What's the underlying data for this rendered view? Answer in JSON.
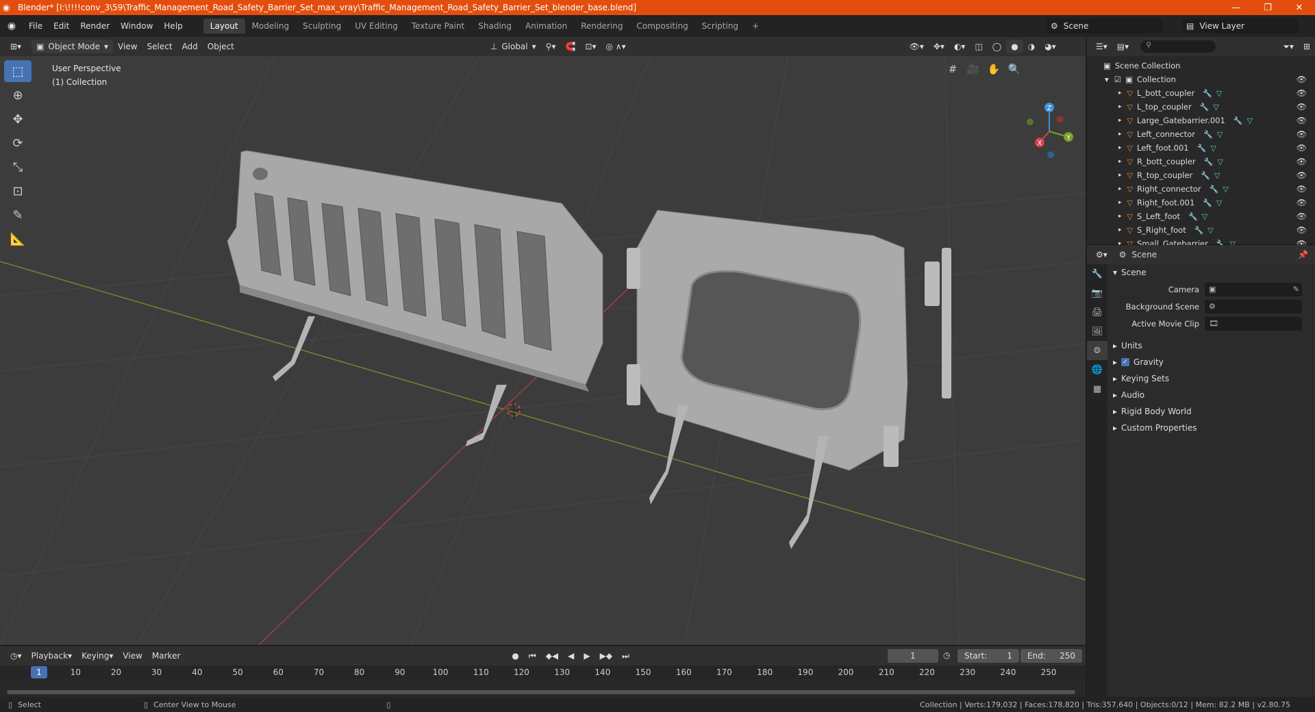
{
  "titlebar": {
    "text": "Blender* [I:\\!!!!conv_3\\59\\Traffic_Management_Road_Safety_Barrier_Set_max_vray\\Traffic_Management_Road_Safety_Barrier_Set_blender_base.blend]",
    "minimize": "—",
    "maximize": "❐",
    "close": "✕"
  },
  "menu": [
    "File",
    "Edit",
    "Render",
    "Window",
    "Help"
  ],
  "workspaces": [
    "Layout",
    "Modeling",
    "Sculpting",
    "UV Editing",
    "Texture Paint",
    "Shading",
    "Animation",
    "Rendering",
    "Compositing",
    "Scripting"
  ],
  "workspace_add": "+",
  "scene_name": "Scene",
  "view_layer": "View Layer",
  "viewport_header": {
    "mode": "Object Mode",
    "view": "View",
    "select": "Select",
    "add": "Add",
    "object": "Object",
    "orientation": "Global"
  },
  "viewport": {
    "perspective": "User Perspective",
    "collection": "(1) Collection",
    "gizmo_axes": {
      "x": "X",
      "y": "Y",
      "z": "Z"
    }
  },
  "timeline": {
    "playback": "Playback",
    "keying": "Keying",
    "view": "View",
    "marker": "Marker",
    "current_frame": "1",
    "start_label": "Start:",
    "start": "1",
    "end_label": "End:",
    "end": "250",
    "ruler": [
      "10",
      "20",
      "30",
      "40",
      "50",
      "60",
      "70",
      "80",
      "90",
      "100",
      "110",
      "120",
      "130",
      "140",
      "150",
      "160",
      "170",
      "180",
      "190",
      "200",
      "210",
      "220",
      "230",
      "240",
      "250"
    ]
  },
  "statusbar": {
    "select": "Select",
    "center_view": "Center View to Mouse",
    "stats": "Collection | Verts:179,032 | Faces:178,820 | Tris:357,640 | Objects:0/12 | Mem: 82.2 MB | v2.80.75"
  },
  "outliner": {
    "search_placeholder": "",
    "scene_collection": "Scene Collection",
    "collection": "Collection",
    "objects": [
      "L_bott_coupler",
      "L_top_coupler",
      "Large_Gatebarrier.001",
      "Left_connector",
      "Left_foot.001",
      "R_bott_coupler",
      "R_top_coupler",
      "Right_connector",
      "Right_foot.001",
      "S_Left_foot",
      "S_Right_foot",
      "Small_Gatebarrier"
    ]
  },
  "properties": {
    "header": "Scene",
    "panel": "Scene",
    "camera_label": "Camera",
    "background_label": "Background Scene",
    "movieclip_label": "Active Movie Clip",
    "subpanels": [
      "Units",
      "Gravity",
      "Keying Sets",
      "Audio",
      "Rigid Body World",
      "Custom Properties"
    ]
  },
  "colors": {
    "titlebar": "#e34e0e",
    "accent": "#4772b3",
    "viewport_bg": "#3c3c3c",
    "x_axis": "#d6434b",
    "y_axis": "#7ba12a",
    "z_axis": "#3d8fd6"
  }
}
